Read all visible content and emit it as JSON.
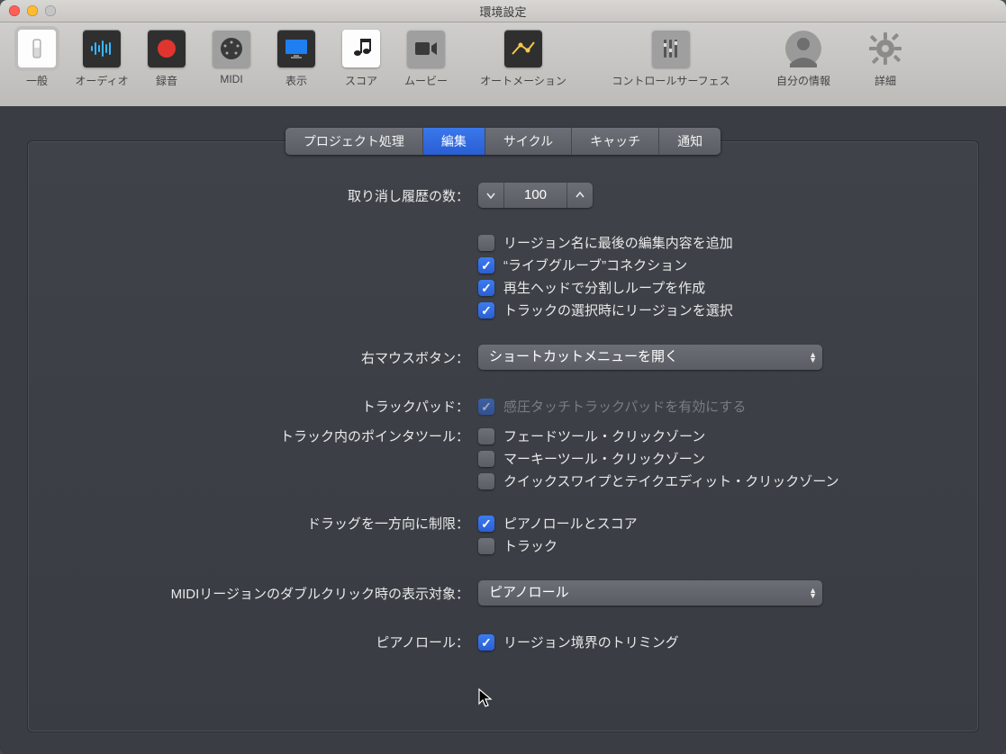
{
  "window_title": "環境設定",
  "toolbar": {
    "items": [
      {
        "label": "一般"
      },
      {
        "label": "オーディオ"
      },
      {
        "label": "録音"
      },
      {
        "label": "MIDI"
      },
      {
        "label": "表示"
      },
      {
        "label": "スコア"
      },
      {
        "label": "ムービー"
      },
      {
        "label": "オートメーション"
      },
      {
        "label": "コントロールサーフェス"
      },
      {
        "label": "自分の情報"
      },
      {
        "label": "詳細"
      }
    ]
  },
  "tabs": [
    "プロジェクト処理",
    "編集",
    "サイクル",
    "キャッチ",
    "通知"
  ],
  "active_tab": "編集",
  "form": {
    "undo_label": "取り消し履歴の数：",
    "undo_value": "100",
    "cb_region_name": "リージョン名に最後の編集内容を追加",
    "cb_live_groove": "“ライブグルーブ”コネクション",
    "cb_playhead_loop": "再生ヘッドで分割しループを作成",
    "cb_select_region": "トラックの選択時にリージョンを選択",
    "right_mouse_label": "右マウスボタン：",
    "right_mouse_value": "ショートカットメニューを開く",
    "trackpad_label": "トラックパッド：",
    "trackpad_cb": "感圧タッチトラックパッドを有効にする",
    "pointer_label": "トラック内のポインタツール：",
    "cb_fade": "フェードツール・クリックゾーン",
    "cb_marquee": "マーキーツール・クリックゾーン",
    "cb_quick": "クイックスワイプとテイクエディット・クリックゾーン",
    "drag_label": "ドラッグを一方向に制限：",
    "cb_piano_score": "ピアノロールとスコア",
    "cb_track": "トラック",
    "midi_dbl_label": "MIDIリージョンのダブルクリック時の表示対象：",
    "midi_dbl_value": "ピアノロール",
    "pianoroll_label": "ピアノロール：",
    "cb_trim": "リージョン境界のトリミング"
  }
}
